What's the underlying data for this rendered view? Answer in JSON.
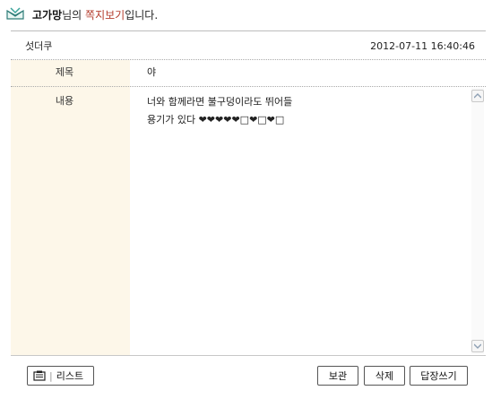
{
  "header": {
    "user_name": "고가망",
    "suffix_1": "님의 ",
    "page_name": "쪽지보기",
    "suffix_2": "입니다."
  },
  "message": {
    "sender": "섯더쿠",
    "date": "2012-07-11 16:40:46",
    "subject_label": "제목",
    "subject": "야",
    "content_label": "내용",
    "content": "너와 함께라면 불구덩이라도 뛰어들\n용기가 있다 ❤❤❤❤❤□❤□❤□"
  },
  "buttons": {
    "list": "리스트",
    "save": "보관",
    "delete": "삭제",
    "reply": "답장쓰기"
  },
  "colors": {
    "accent": "#b43c2c",
    "label_bg": "#fdf7e9"
  }
}
